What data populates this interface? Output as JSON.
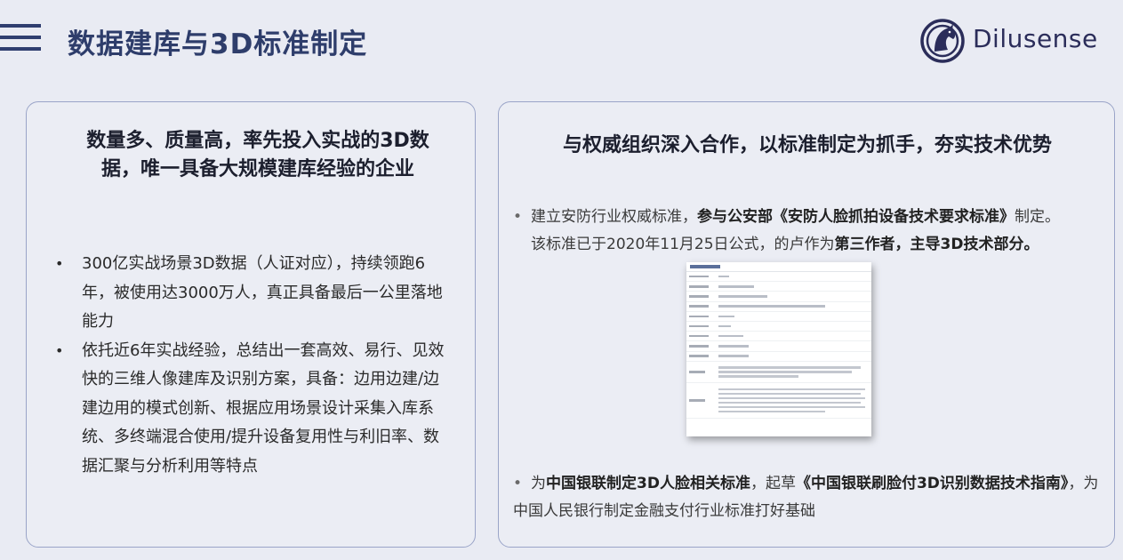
{
  "header": {
    "title": "数据建库与3D标准制定",
    "logo_text": "Dilusense"
  },
  "left_panel": {
    "heading_line1": "数量多、质量高，率先投入实战的3D数",
    "heading_line2": "据，唯一具备大规模建库经验的企业",
    "bullets": [
      "300亿实战场景3D数据（人证对应），持续领跑6年，被使用达3000万人，真正具备最后一公里落地能力",
      "依托近6年实战经验，总结出一套高效、易行、见效快的三维人像建库及识别方案，具备：边用边建/边建边用的模式创新、根据应用场景设计采集入库系统、多终端混合使用/提升设备复用性与利旧率、数据汇聚与分析利用等特点"
    ]
  },
  "right_panel": {
    "heading": "与权威组织深入合作，以标准制定为抓手，夯实技术优势",
    "bullet1": {
      "part1": "建立安防行业权威标准，",
      "part2_bold": "参与公安部《安防人脸抓拍设备技术要求标准》",
      "part3": "制定。",
      "part4": "该标准已于2020年11月25日公式，的卢作为",
      "part5_bold": "第三作者，主导3D技术部分。"
    },
    "bullet2": {
      "part1": "为",
      "part2_bold": "中国银联制定3D人脸相关标准",
      "part3": "，起草",
      "part4_bold": "《中国银联刷脸付3D识别数据技术指南》",
      "part5": "，为中国人民银行制定金融支付行业标准打好基础"
    }
  },
  "colors": {
    "title": "#2e3d6b",
    "panel_border": "#9aa4c8",
    "background": "#e9ebf3"
  }
}
